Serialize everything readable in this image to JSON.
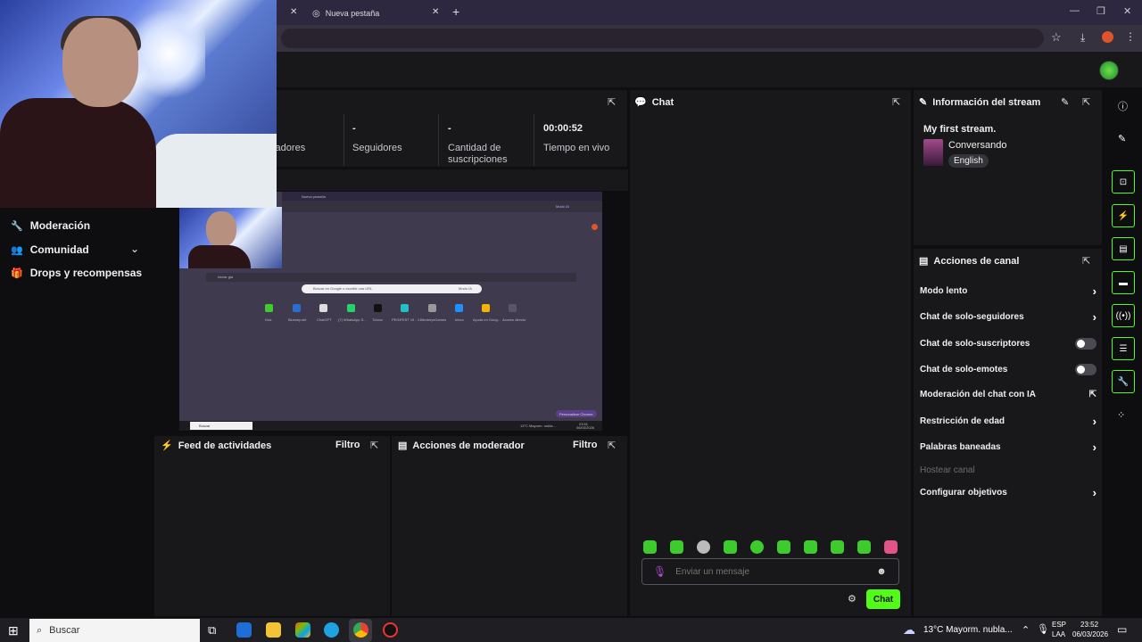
{
  "browser": {
    "tabs": [
      {
        "label": ""
      },
      {
        "label": "Nueva pestaña"
      }
    ],
    "new_tab": "+",
    "star": "☆"
  },
  "stats": [
    {
      "value": "",
      "label": "ctadores"
    },
    {
      "value": "-",
      "label": "Seguidores"
    },
    {
      "value": "-",
      "label": "Cantidad de suscripciones"
    },
    {
      "value": "00:00:52",
      "label": "Tiempo en vivo"
    }
  ],
  "left_menu": [
    {
      "label": "Moderación",
      "icon": "wrench-icon"
    },
    {
      "label": "Comunidad",
      "icon": "users-icon"
    },
    {
      "label": "Drops y recompensas",
      "icon": "gift-icon"
    }
  ],
  "preview": {
    "tab_label": "Nueva pestaña",
    "search_placeholder": "Buscar en Google o escribir una URL",
    "search_button": "Modo IA",
    "side_text": "Iniciar gia",
    "top_right_btn": "Modo IA",
    "shortcuts": [
      "Kick",
      "Bluesky.net",
      "ChatGPT",
      "(7) WhatsApp S...",
      "Tutoxz",
      "PEGIFEST 19 - 1...",
      "BlenkeysGames",
      "Inbox",
      "Ayuda en Goog...",
      "Acceso directo"
    ],
    "customize": "Personalizar Chrome",
    "taskbar_search": "Buscar",
    "tray_weather": "13°C Mayorm. nubla...",
    "tray_time": "23:51",
    "tray_date": "06/03/2026"
  },
  "activity_feed": {
    "title": "Feed de actividades",
    "filter": "Filtro"
  },
  "mod_actions": {
    "title": "Acciones de moderador",
    "filter": "Filtro"
  },
  "chat": {
    "title": "Chat",
    "placeholder": "Enviar un mensaje",
    "send_label": "Chat",
    "emote_count": 10
  },
  "stream_info": {
    "title": "Información del stream",
    "stream_title": "My first stream.",
    "category": "Conversando",
    "language": "English"
  },
  "channel_actions": {
    "title": "Acciones de canal",
    "items": [
      {
        "label": "Modo lento",
        "control": "chevron"
      },
      {
        "label": "Chat de solo-seguidores",
        "control": "chevron"
      },
      {
        "label": "Chat de solo-suscriptores",
        "control": "toggle",
        "on": false
      },
      {
        "label": "Chat de solo-emotes",
        "control": "toggle",
        "on": false
      },
      {
        "label": "Moderación del chat con IA",
        "control": "external"
      },
      {
        "label": "Restricción de edad",
        "control": "chevron"
      },
      {
        "label": "Palabras baneadas",
        "control": "chevron"
      },
      {
        "label": "Hostear canal",
        "control": "none",
        "disabled": true
      },
      {
        "label": "Configurar objetivos",
        "control": "chevron"
      }
    ]
  },
  "taskbar": {
    "search": "Buscar",
    "weather": "13°C  Mayorm. nubla...",
    "lang_top": "ESP",
    "lang_bottom": "LAA",
    "time": "23:52",
    "date": "06/03/2026"
  },
  "colors": {
    "accent": "#53fc18",
    "panel": "#18181b",
    "background": "#0e0e10"
  }
}
